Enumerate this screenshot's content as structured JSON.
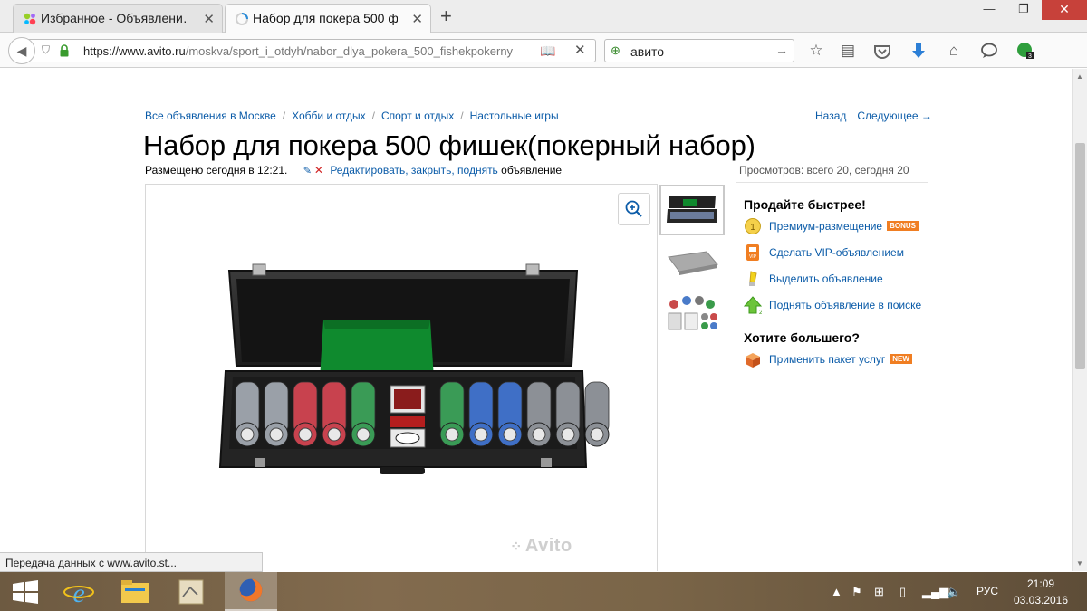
{
  "browser": {
    "tabs": [
      {
        "label": "Избранное - Объявлени…",
        "active": false
      },
      {
        "label": "Набор для покера 500 ф…",
        "active": true
      }
    ],
    "new_tab": "+",
    "url": {
      "host": "https://www.avito.ru",
      "path": "/moskva/sport_i_otdyh/nabor_dlya_pokera_500_fishekpokerny"
    },
    "search": {
      "value": "авито"
    },
    "status_text": "Передача данных с www.avito.st..."
  },
  "page": {
    "breadcrumbs": [
      "Все объявления в Москве",
      "Хобби и отдых",
      "Спорт и отдых",
      "Настольные игры"
    ],
    "nav": {
      "back": "Назад",
      "next": "Следующее →"
    },
    "title": "Набор для покера 500 фишек(покерный набор)",
    "posted": "Размещено сегодня в 12:21.",
    "edit_links": "Редактировать, закрыть, поднять",
    "edit_suffix": "объявление",
    "views": "Просмотров: всего 20, сегодня 20",
    "watermark": "Avito"
  },
  "sidebar": {
    "sell_faster_heading": "Продайте быстрее!",
    "items": [
      {
        "label": "Премиум-размещение",
        "badge": "BONUS",
        "icon": "premium-coin-icon"
      },
      {
        "label": "Сделать VIP-объявлением",
        "badge": "",
        "icon": "vip-icon"
      },
      {
        "label": "Выделить объявление",
        "badge": "",
        "icon": "highlighter-icon"
      },
      {
        "label": "Поднять объявление в поиске",
        "badge": "",
        "icon": "raise-arrow-icon"
      }
    ],
    "want_more_heading": "Хотите большего?",
    "package": {
      "label": "Применить пакет услуг",
      "badge": "NEW",
      "icon": "package-box-icon"
    }
  },
  "taskbar": {
    "language": "РУС",
    "time": "21:09",
    "date": "03.03.2016"
  },
  "colors": {
    "link": "#0a5ba8",
    "badge_orange": "#f07e22",
    "close_red": "#c7413a"
  }
}
